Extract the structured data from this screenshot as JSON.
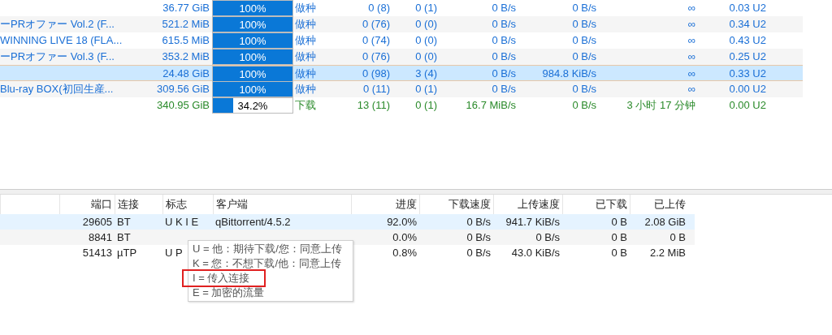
{
  "torrents": [
    {
      "size": "36.77 GiB",
      "level": 1,
      "progress": "100%",
      "kind": "seeding",
      "status": "做种",
      "seeds": "0 (8)",
      "peers": "0 (1)",
      "down_speed": "0 B/s",
      "up_speed": "0 B/s",
      "eta": "∞",
      "ratio": "0.03 U2",
      "selected": false
    },
    {
      "name": "ーPRオファー Vol.2 (F...",
      "size": "521.2 MiB",
      "level": 1,
      "progress": "100%",
      "kind": "seeding",
      "status": "做种",
      "seeds": "0 (76)",
      "peers": "0 (0)",
      "down_speed": "0 B/s",
      "up_speed": "0 B/s",
      "eta": "∞",
      "ratio": "0.34 U2",
      "selected": false
    },
    {
      "name": "WINNING LIVE 18 (FLA...",
      "size": "615.5 MiB",
      "level": 1,
      "progress": "100%",
      "kind": "seeding",
      "status": "做种",
      "seeds": "0 (74)",
      "peers": "0 (0)",
      "down_speed": "0 B/s",
      "up_speed": "0 B/s",
      "eta": "∞",
      "ratio": "0.43 U2",
      "selected": false
    },
    {
      "name": "ーPRオファー Vol.3 (F...",
      "size": "353.2 MiB",
      "level": 1,
      "progress": "100%",
      "kind": "seeding",
      "status": "做种",
      "seeds": "0 (76)",
      "peers": "0 (0)",
      "down_speed": "0 B/s",
      "up_speed": "0 B/s",
      "eta": "∞",
      "ratio": "0.25 U2",
      "selected": false
    },
    {
      "size": "24.48 GiB",
      "level": 1,
      "progress": "100%",
      "kind": "seeding",
      "status": "做种",
      "seeds": "0 (98)",
      "peers": "3 (4)",
      "down_speed": "0 B/s",
      "up_speed": "984.8 KiB/s",
      "eta": "∞",
      "ratio": "0.33 U2",
      "selected": true
    },
    {
      "name": "Blu-ray BOX(初回生産...",
      "size": "309.56 GiB",
      "level": 1,
      "progress": "100%",
      "kind": "seeding",
      "status": "做种",
      "seeds": "0 (11)",
      "peers": "0 (1)",
      "down_speed": "0 B/s",
      "up_speed": "0 B/s",
      "eta": "∞",
      "ratio": "0.00 U2",
      "selected": false
    },
    {
      "size": "340.95 GiB",
      "level": 0.25,
      "progress": "34.2%",
      "kind": "downloading",
      "status": "下载",
      "seeds": "13 (11)",
      "peers": "0 (1)",
      "down_speed": "16.7 MiB/s",
      "up_speed": "0 B/s",
      "eta": "3 小时 17 分钟",
      "ratio": "0.00 U2",
      "selected": false
    }
  ],
  "peers_table": {
    "columns": [
      "端口",
      "连接",
      "标志",
      "客户端",
      "进度",
      "下载速度",
      "上传速度",
      "已下载",
      "已上传"
    ],
    "rows": [
      {
        "port": "29605",
        "connection": "BT",
        "flags": "U K I E",
        "client": "qBittorrent/4.5.2",
        "progress": "92.0%",
        "down_speed": "0 B/s",
        "up_speed": "941.7 KiB/s",
        "downloaded": "0 B",
        "uploaded": "2.08 GiB",
        "selected": true
      },
      {
        "port": "8841",
        "connection": "BT",
        "progress": "0.0%",
        "down_speed": "0 B/s",
        "up_speed": "0 B/s",
        "downloaded": "0 B",
        "uploaded": "0 B",
        "selected": false
      },
      {
        "port": "51413",
        "connection": "µTP",
        "flags": "U P",
        "progress": "0.8%",
        "down_speed": "0 B/s",
        "up_speed": "43.0 KiB/s",
        "downloaded": "0 B",
        "uploaded": "2.2 MiB",
        "selected": false
      }
    ]
  },
  "tooltip": {
    "lines": [
      {
        "text": "U = 他：期待下载/您：同意上传",
        "highlighted": false
      },
      {
        "text": "K = 您：不想下载/他：同意上传",
        "highlighted": false
      },
      {
        "text": "I = 传入连接",
        "highlighted": true
      },
      {
        "text": "E = 加密的流量",
        "highlighted": false
      }
    ]
  }
}
